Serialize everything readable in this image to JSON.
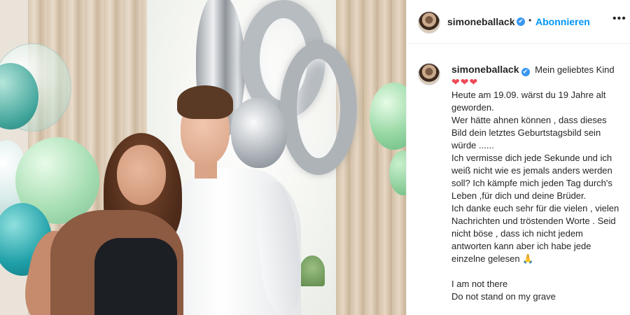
{
  "post": {
    "image_alt": "Zwei Personen vor Luftballons",
    "header": {
      "username": "simoneballack",
      "verified_icon": "✔",
      "separator": "•",
      "follow_label": "Abonnieren",
      "more_label": "•••"
    },
    "caption": {
      "username": "simoneballack",
      "verified_icon": "✔",
      "first_line": "Mein geliebtes Kind",
      "hearts": "❤❤❤",
      "text": "Heute am 19.09. wärst du 19 Jahre alt geworden.\nWer hätte ahnen können , dass dieses Bild dein letztes Geburtstagsbild sein würde ......\nIch vermisse dich jede Sekunde und ich weiß nicht wie es jemals anders werden soll? Ich kämpfe mich jeden Tag durch's Leben ,für dich und deine Brüder.\nIch danke euch sehr für die vielen , vielen Nachrichten und tröstenden Worte . Seid nicht böse , dass ich nicht jedem antworten kann aber ich habe jede einzelne gelesen 🙏\n\nI am not there\nDo not stand on my grave"
    }
  },
  "colors": {
    "link_blue": "#0095f6",
    "verified_blue": "#3897f0",
    "heart_red": "#ed4956",
    "text": "#262626"
  }
}
